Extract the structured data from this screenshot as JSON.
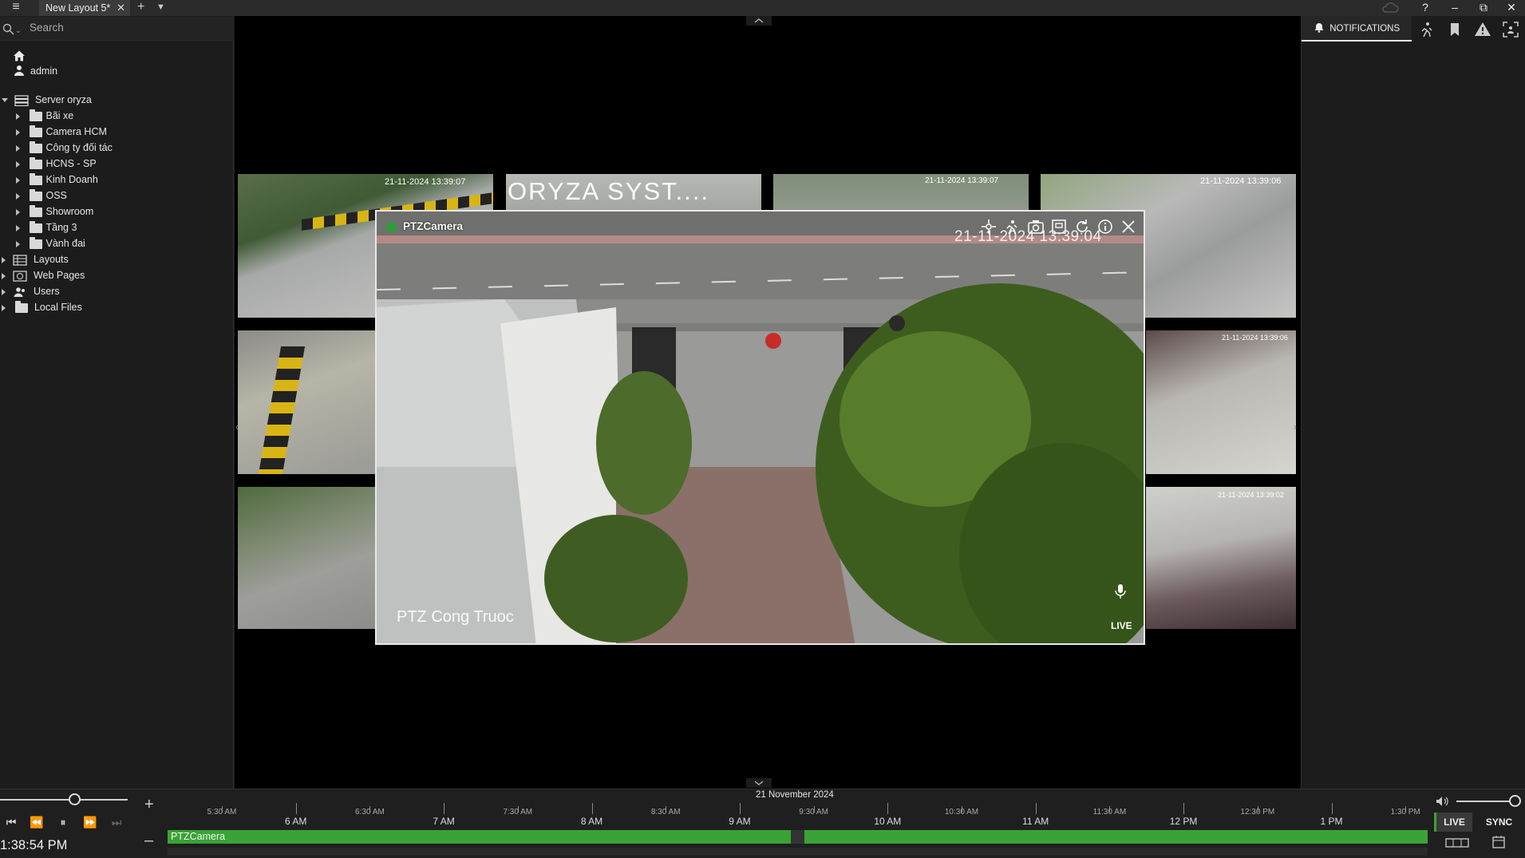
{
  "window": {
    "tab_title": "New Layout 5*",
    "tab_close": "✕",
    "add_tab": "+",
    "tab_dropdown": "⌄",
    "help": "?",
    "minimize": "–",
    "restore": "⧉",
    "close": "✕"
  },
  "sidebar": {
    "search_placeholder": "Search",
    "user": "admin",
    "server": "Server oryza",
    "folders": [
      "Bãi xe",
      "Camera HCM",
      "Công ty đối tác",
      "HCNS - SP",
      "Kinh Doanh",
      "OSS",
      "Showroom",
      "Tầng 3",
      "Vành đai"
    ],
    "sections": [
      "Layouts",
      "Web Pages",
      "Users",
      "Local Files"
    ]
  },
  "right_panel": {
    "notifications": "NOTIFICATIONS"
  },
  "grid": {
    "thumb1_ts": "21-11-2024 13:39:07",
    "thumb2_text": "ORYZA SYST....",
    "thumb3_ts": "21-11-2024 13:39:07",
    "thumb4_ts": "21-11-2024 13:39:06",
    "thumb6_ts": "21-11-2024 13:39:06",
    "thumb8_ts": "21-11-2024 13:39:02"
  },
  "popup": {
    "camera_name": "PTZCamera",
    "timestamp": "21-11-2024 13:39:04",
    "overlay_label": "PTZ Cong Truoc",
    "live_tag": "LIVE",
    "status_color": "#2e9b3a"
  },
  "timeline": {
    "date": "21 November 2024",
    "clock": "1:38:54 PM",
    "track_label": "PTZCamera",
    "zoom_in": "+",
    "zoom_out": "–",
    "labels": [
      {
        "text": "5:30 AM",
        "major": false
      },
      {
        "text": "6 AM",
        "major": true
      },
      {
        "text": "6:30 AM",
        "major": false
      },
      {
        "text": "7 AM",
        "major": true
      },
      {
        "text": "7:30 AM",
        "major": false
      },
      {
        "text": "8 AM",
        "major": true
      },
      {
        "text": "8:30 AM",
        "major": false
      },
      {
        "text": "9 AM",
        "major": true
      },
      {
        "text": "9:30 AM",
        "major": false
      },
      {
        "text": "10 AM",
        "major": true
      },
      {
        "text": "10:30 AM",
        "major": false
      },
      {
        "text": "11 AM",
        "major": true
      },
      {
        "text": "11:30 AM",
        "major": false
      },
      {
        "text": "12 PM",
        "major": true
      },
      {
        "text": "12:30 PM",
        "major": false
      },
      {
        "text": "1 PM",
        "major": true
      },
      {
        "text": "1:30 PM",
        "major": false
      }
    ],
    "live_button": "LIVE",
    "sync_button": "SYNC",
    "track_color": "#3aa335"
  }
}
